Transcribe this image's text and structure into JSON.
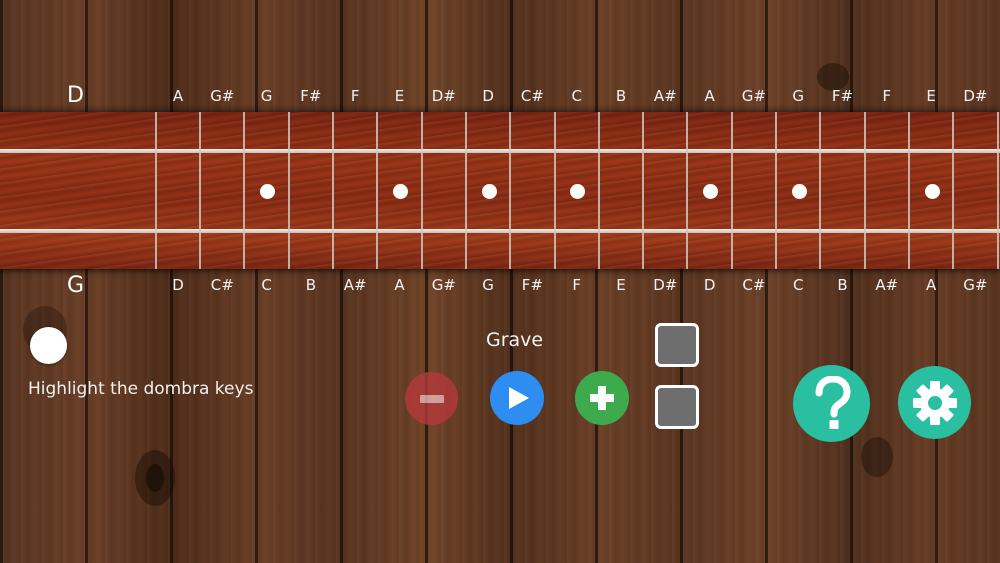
{
  "top_string": {
    "label": "D",
    "notes": [
      "A",
      "G#",
      "G",
      "F#",
      "F",
      "E",
      "D#",
      "D",
      "C#",
      "C",
      "B",
      "A#",
      "A",
      "G#",
      "G",
      "F#",
      "F",
      "E",
      "D#"
    ]
  },
  "bottom_string": {
    "label": "G",
    "notes": [
      "D",
      "C#",
      "C",
      "B",
      "A#",
      "A",
      "G#",
      "G",
      "F#",
      "F",
      "E",
      "D#",
      "D",
      "C#",
      "C",
      "B",
      "A#",
      "A",
      "G#"
    ]
  },
  "fretboard": {
    "marker_frets": [
      3,
      6,
      8,
      10,
      13,
      15,
      18
    ]
  },
  "highlight": {
    "label": "Highlight the dombra keys",
    "enabled": true
  },
  "tempo": {
    "label": "Grave"
  },
  "icons": {
    "minus": "minus-icon",
    "play": "play-icon",
    "plus": "plus-icon",
    "help": "question-mark-icon",
    "settings": "gear-icon"
  },
  "colors": {
    "minus": "#b4393a",
    "play": "#2d8df0",
    "plus": "#3eaa4e",
    "help": "#2bbfa1",
    "settings": "#2bbfa1",
    "square": "#6e6e6e"
  }
}
